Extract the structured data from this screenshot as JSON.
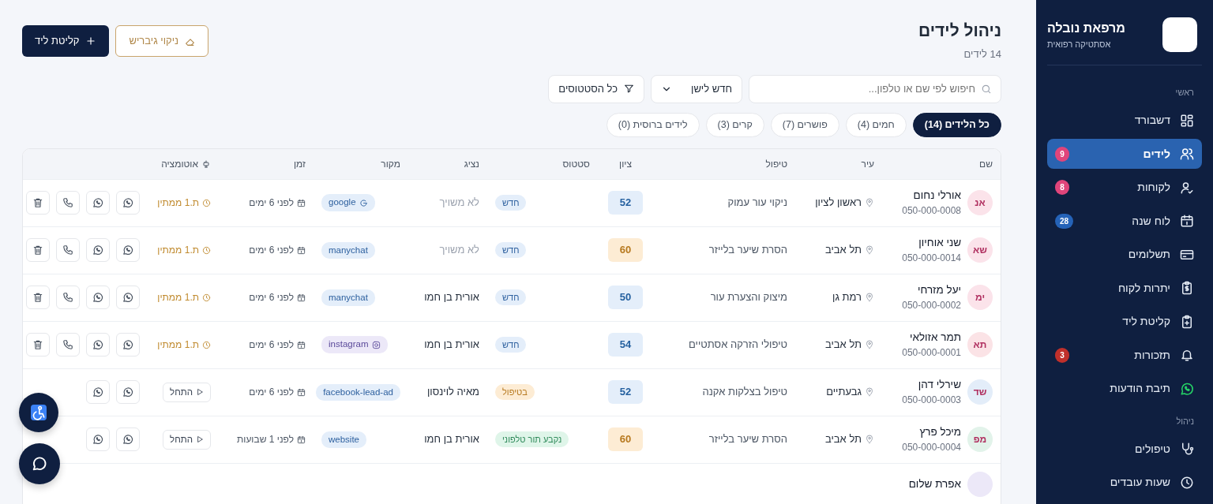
{
  "sidebar": {
    "brand": {
      "title": "מרפאת נובלה",
      "subtitle": "אסתטיקה רפואית"
    },
    "sections": [
      {
        "title": "ראשי",
        "items": [
          {
            "label": "דשבורד",
            "selected": false
          },
          {
            "label": "לידים",
            "selected": true,
            "badge": "9",
            "color": "#e0457b"
          },
          {
            "label": "לקוחות",
            "selected": false,
            "badge": "8",
            "color": "#e0457b"
          },
          {
            "label": "לוח שנה",
            "selected": false,
            "badge": "28",
            "color": "#2563b8"
          },
          {
            "label": "תשלומים",
            "selected": false
          },
          {
            "label": "יתרות לקוח",
            "selected": false
          },
          {
            "label": "קליטת ליד",
            "selected": false
          },
          {
            "label": "תזכורות",
            "selected": false,
            "badge": "3",
            "color": "#c0302b"
          },
          {
            "label": "תיבת הודעות",
            "selected": false
          }
        ]
      },
      {
        "title": "ניהול",
        "items": [
          {
            "label": "טיפולים",
            "selected": false
          },
          {
            "label": "שעות עובדים",
            "selected": false
          }
        ]
      }
    ]
  },
  "header": {
    "title": "ניהול לידים",
    "count": "14 לידים",
    "buttons": [
      {
        "label": "ניקוי גיבריש",
        "kind": "outline"
      },
      {
        "label": "קליטת ליד",
        "kind": "primary"
      }
    ]
  },
  "filters": {
    "search": {
      "placeholder": "חיפוש לפי שם או טלפון..."
    },
    "sort": "חדש לישן",
    "status": "כל הסטטוסים"
  },
  "tabs": [
    {
      "label": "כל הלידים (14)",
      "selected": true
    },
    {
      "label": "חמים (4)",
      "selected": false
    },
    {
      "label": "פושרים (7)",
      "selected": false
    },
    {
      "label": "קרים (3)",
      "selected": false
    },
    {
      "label": "לידים ברוסית (0)",
      "selected": false
    }
  ],
  "table": {
    "columns": [
      "שם",
      "עיר",
      "טיפול",
      "ציון",
      "סטטוס",
      "נציג",
      "מקור",
      "זמן",
      "אוטומציה"
    ],
    "rows": [
      {
        "initials": "אנ",
        "color": "#fbe3ea",
        "name": "אורלי נחום",
        "phone": "050-000-0008",
        "city": "ראשון לציון",
        "treatment": "ניקוי עור עמוק",
        "score": {
          "value": "52",
          "color": "#e4eefa"
        },
        "status": {
          "label": "חדש",
          "kind": "new"
        },
        "rep": "לא משויך",
        "rep_assigned": false,
        "source": {
          "label": "google",
          "kind": "google"
        },
        "time": "לפני 6 ימים",
        "automation": {
          "label": "ת.1 ממתין",
          "kind": "waiting"
        }
      },
      {
        "initials": "שא",
        "color": "#fbe3ea",
        "name": "שני אוחיון",
        "phone": "050-000-0014",
        "city": "תל אביב",
        "treatment": "הסרת שיער בלייזר",
        "score": {
          "value": "60",
          "color": "#fdecd4"
        },
        "status": {
          "label": "חדש",
          "kind": "new"
        },
        "rep": "לא משויך",
        "rep_assigned": false,
        "source": {
          "label": "manychat",
          "kind": "plain"
        },
        "time": "לפני 6 ימים",
        "automation": {
          "label": "ת.1 ממתין",
          "kind": "waiting"
        }
      },
      {
        "initials": "ימ",
        "color": "#fbe3ea",
        "name": "יעל מזרחי",
        "phone": "050-000-0002",
        "city": "רמת גן",
        "treatment": "מיצוק והצערת עור",
        "score": {
          "value": "50",
          "color": "#e4eefa"
        },
        "status": {
          "label": "חדש",
          "kind": "new"
        },
        "rep": "אורית בן חמו",
        "rep_assigned": true,
        "source": {
          "label": "manychat",
          "kind": "plain"
        },
        "time": "לפני 6 ימים",
        "automation": {
          "label": "ת.1 ממתין",
          "kind": "waiting"
        }
      },
      {
        "initials": "תא",
        "color": "#fbe3e6",
        "name": "תמר אזולאי",
        "phone": "050-000-0001",
        "city": "תל אביב",
        "treatment": "טיפולי הזרקה אסתטיים",
        "score": {
          "value": "54",
          "color": "#e4eefa"
        },
        "status": {
          "label": "חדש",
          "kind": "new"
        },
        "rep": "אורית בן חמו",
        "rep_assigned": true,
        "source": {
          "label": "instagram",
          "kind": "instagram"
        },
        "time": "לפני 6 ימים",
        "automation": {
          "label": "ת.1 ממתין",
          "kind": "waiting"
        }
      },
      {
        "initials": "שד",
        "color": "#e3edf9",
        "name": "שירלי דהן",
        "phone": "050-000-0003",
        "city": "גבעתיים",
        "treatment": "טיפול בצלקות אקנה",
        "score": {
          "value": "52",
          "color": "#e4eefa"
        },
        "status": {
          "label": "בטיפול",
          "kind": "treatment"
        },
        "rep": "מאיה לוינסון",
        "rep_assigned": true,
        "source": {
          "label": "facebook-lead-ad",
          "kind": "plain"
        },
        "time": "לפני 6 ימים",
        "automation": {
          "label": "התחל",
          "kind": "start"
        }
      },
      {
        "initials": "מפ",
        "color": "#e2f3ea",
        "name": "מיכל פרץ",
        "phone": "050-000-0004",
        "city": "תל אביב",
        "treatment": "הסרת שיער בלייזר",
        "score": {
          "value": "60",
          "color": "#fdecd4"
        },
        "status": {
          "label": "נקבע תור טלפוני",
          "kind": "booked"
        },
        "rep": "אורית בן חמו",
        "rep_assigned": true,
        "source": {
          "label": "website",
          "kind": "plain"
        },
        "time": "לפני 1 שבועות",
        "automation": {
          "label": "התחל",
          "kind": "start"
        }
      },
      {
        "color": "#ece8f8",
        "name": "אפרת שלום"
      }
    ]
  }
}
